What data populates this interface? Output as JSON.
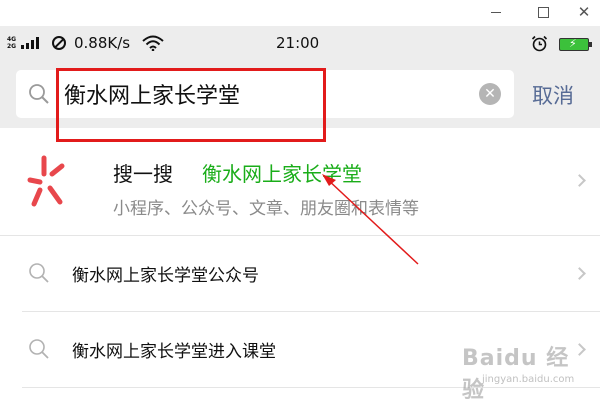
{
  "window": {
    "close_glyph": "✕"
  },
  "status_bar": {
    "network_top": "4G",
    "network_bottom": "2G",
    "speed": "0.88K/s",
    "time": "21:00",
    "battery_color": "#3cc13b",
    "icons": [
      "signal-bars-icon",
      "block-icon",
      "wifi-icon",
      "alarm-icon",
      "battery-icon"
    ]
  },
  "search": {
    "query": "衡水网上家长学堂",
    "clear_glyph": "✕",
    "cancel_label": "取消"
  },
  "results": {
    "sousuo": {
      "label": "搜一搜",
      "query": "衡水网上家长学堂",
      "subtitle": "小程序、公众号、文章、朋友圈和表情等",
      "accent_color": "#1aad19"
    },
    "suggestions": [
      {
        "text": "衡水网上家长学堂公众号"
      },
      {
        "text": "衡水网上家长学堂进入课堂"
      }
    ]
  },
  "annotation": {
    "color": "#e21b1b"
  },
  "watermark": {
    "text": "Baidu 经验",
    "url": "jingyan.baidu.com"
  }
}
